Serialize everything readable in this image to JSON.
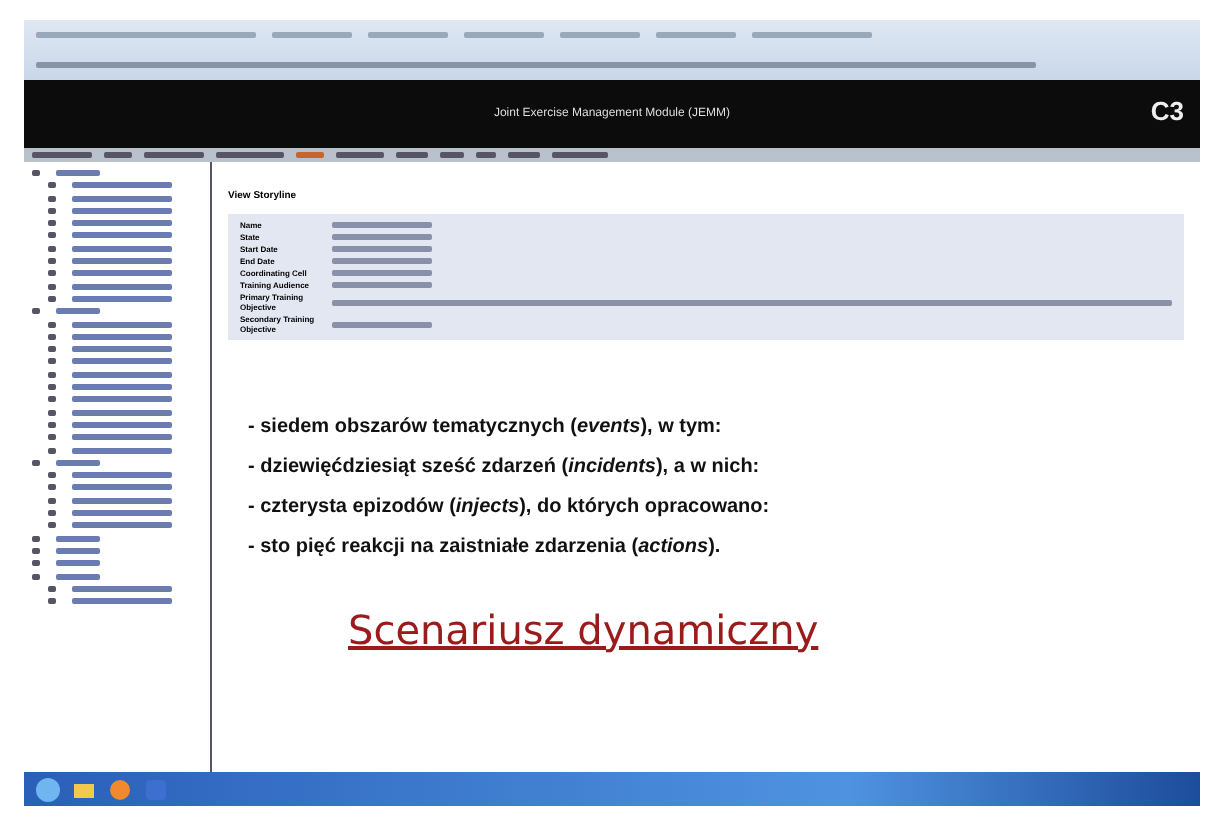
{
  "app": {
    "title": "Joint Exercise Management Module (JEMM)",
    "logo": "C3"
  },
  "view": {
    "heading": "View Storyline",
    "fields": [
      {
        "label": "Name"
      },
      {
        "label": "State"
      },
      {
        "label": "Start Date"
      },
      {
        "label": "End Date"
      },
      {
        "label": "Coordinating Cell"
      },
      {
        "label": "Training Audience"
      },
      {
        "label": "Primary Training Objective"
      },
      {
        "label": "Secondary Training Objective"
      }
    ]
  },
  "slide": {
    "bullets": [
      "- siedem obszarów tematycznych (*events*),  w tym:",
      "- dziewięćdziesiąt sześć zdarzeń (*incidents*),  a w nich:",
      "- czterysta epizodów (*injects*), do których opracowano:",
      "- sto pięć reakcji na zaistniałe zdarzenia  (*actions*)."
    ],
    "title": "Scenariusz dynamiczny"
  }
}
